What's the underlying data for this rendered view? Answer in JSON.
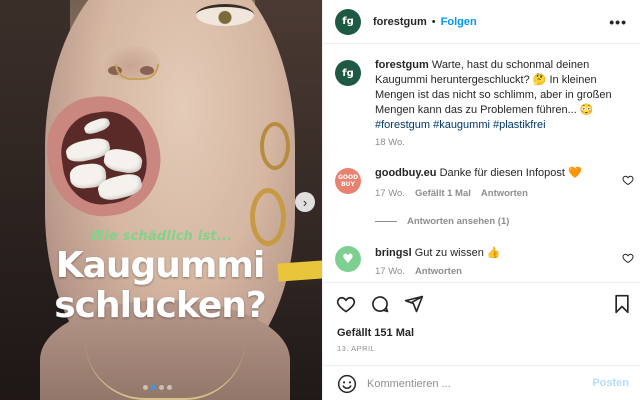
{
  "post": {
    "headline_kicker": "Wie schädlich ist...",
    "headline": "Kaugummi\nschlucken?",
    "carousel_count": 4,
    "carousel_active": 1
  },
  "header": {
    "avatar_text": "fg",
    "username": "forestgum",
    "separator": "•",
    "follow_label": "Folgen",
    "more_label": "•••"
  },
  "caption": {
    "avatar_text": "fg",
    "username": "forestgum",
    "text": "Warte, hast du schonmal deinen Kaugummi heruntergeschluckt? 🤔 In kleinen Mengen ist das nicht so schlimm, aber in großen Mengen kann das zu Problemen führen... 😳",
    "hashtags": "#forestgum #kaugummi #plastikfrei",
    "time": "18 Wo."
  },
  "comments": [
    {
      "avatar_text": "GOOD BUY",
      "username": "goodbuy.eu",
      "text": "Danke für diesen Infopost 🧡",
      "time": "17 Wo.",
      "likes": "Gefällt 1 Mal",
      "reply_label": "Antworten",
      "view_replies": "Antworten ansehen (1)"
    },
    {
      "avatar_text": "♥",
      "username": "bringsl",
      "text": "Gut zu wissen 👍",
      "time": "17 Wo.",
      "reply_label": "Antworten"
    }
  ],
  "actions": {
    "likes": "Gefällt 151 Mal",
    "date": "13. APRIL",
    "comment_placeholder": "Kommentieren ...",
    "post_label": "Posten"
  },
  "colors": {
    "accent": "#0095f6",
    "post_disabled": "#b2dffc",
    "brand": "#1e5a43",
    "kicker": "#7fd48a"
  }
}
